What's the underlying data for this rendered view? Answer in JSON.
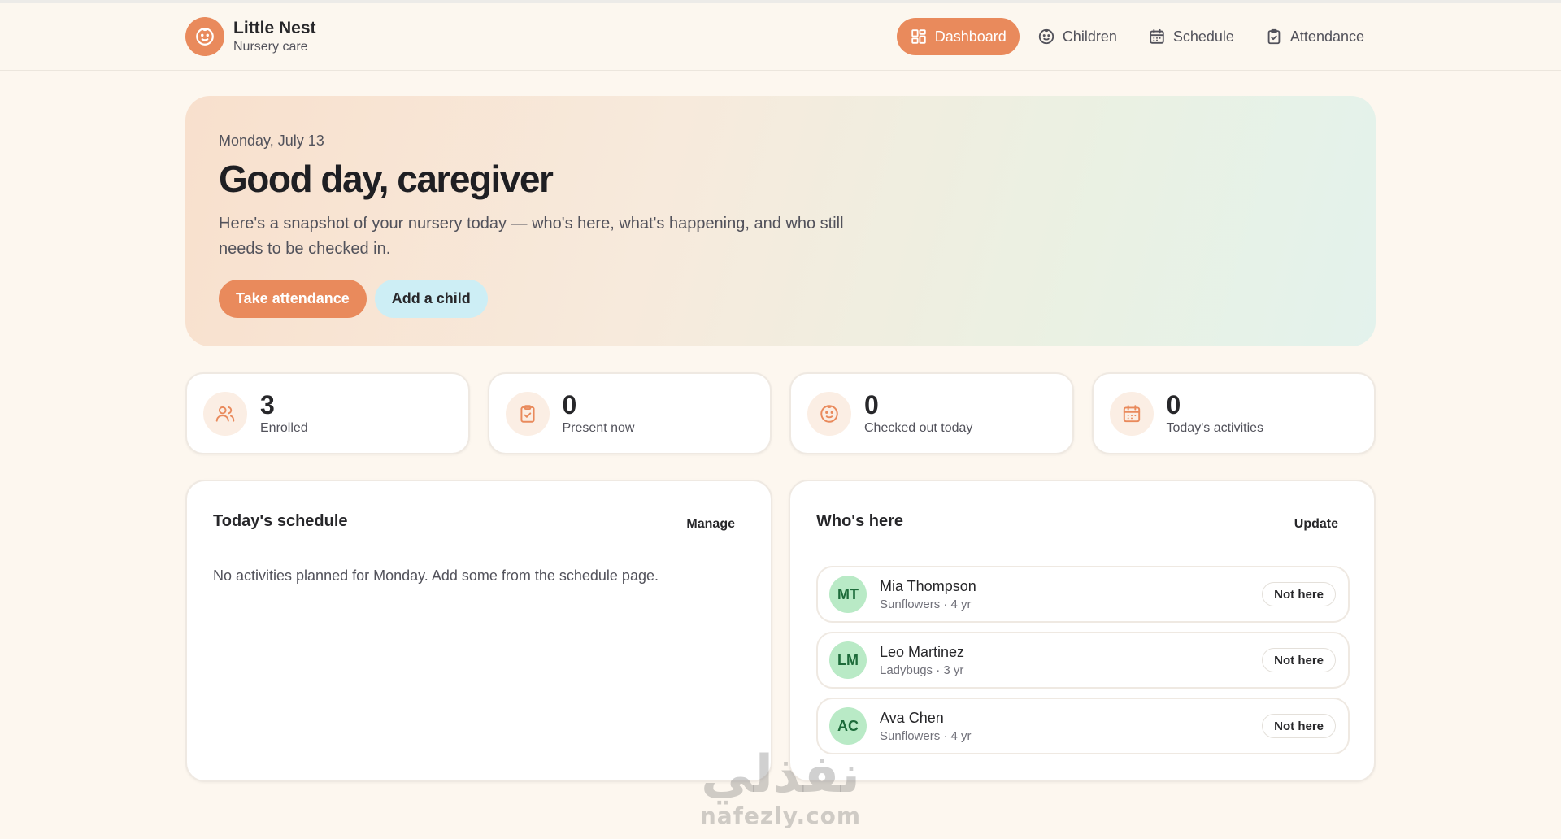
{
  "brand": {
    "name": "Little Nest",
    "subtitle": "Nursery care",
    "logo_icon": "smile-face-icon",
    "accent": "#e98a5c"
  },
  "nav": {
    "items": [
      {
        "label": "Dashboard",
        "icon": "grid-icon",
        "active": true
      },
      {
        "label": "Children",
        "icon": "smile-face-icon",
        "active": false
      },
      {
        "label": "Schedule",
        "icon": "calendar-icon",
        "active": false
      },
      {
        "label": "Attendance",
        "icon": "clipboard-icon",
        "active": false
      }
    ]
  },
  "hero": {
    "date": "Monday, July 13",
    "title": "Good day, caregiver",
    "text": "Here's a snapshot of your nursery today — who's here, what's happening, and who still needs to be checked in.",
    "primary_action": "Take attendance",
    "secondary_action": "Add a child"
  },
  "stats": [
    {
      "value": "3",
      "label": "Enrolled",
      "icon": "users-icon"
    },
    {
      "value": "0",
      "label": "Present now",
      "icon": "clipboard-icon"
    },
    {
      "value": "0",
      "label": "Checked out today",
      "icon": "smile-face-icon"
    },
    {
      "value": "0",
      "label": "Today's activities",
      "icon": "calendar-icon"
    }
  ],
  "schedule": {
    "title": "Today's schedule",
    "action": "Manage",
    "empty_text": "No activities planned for Monday. Add some from the schedule page."
  },
  "whos_here": {
    "title": "Who's here",
    "action": "Update",
    "children": [
      {
        "initials": "MT",
        "name": "Mia Thompson",
        "meta": "Sunflowers · 4 yr",
        "status": "Not here"
      },
      {
        "initials": "LM",
        "name": "Leo Martinez",
        "meta": "Ladybugs · 3 yr",
        "status": "Not here"
      },
      {
        "initials": "AC",
        "name": "Ava Chen",
        "meta": "Sunflowers · 4 yr",
        "status": "Not here"
      }
    ]
  },
  "watermark": {
    "arabic": "نفذلي",
    "url": "nafezly.com"
  }
}
